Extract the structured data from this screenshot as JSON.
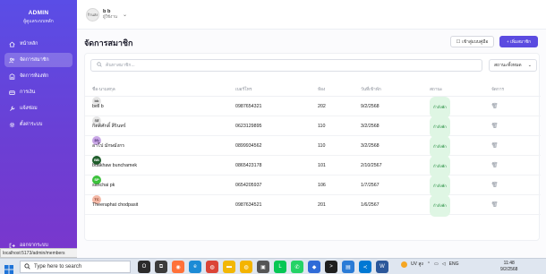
{
  "sidebar": {
    "title": "ADMIN",
    "subtitle": "ผู้ดูแลระบบหลัก",
    "items": [
      {
        "label": "หน้าหลัก",
        "icon": "home-icon",
        "active": false
      },
      {
        "label": "จัดการสมาชิก",
        "icon": "users-icon",
        "active": true
      },
      {
        "label": "จัดการห้องพัก",
        "icon": "room-icon",
        "active": false
      },
      {
        "label": "การเงิน",
        "icon": "wallet-icon",
        "active": false
      },
      {
        "label": "แจ้งซ่อม",
        "icon": "wrench-icon",
        "active": false
      },
      {
        "label": "ตั้งค่าระบบ",
        "icon": "gear-icon",
        "active": false
      }
    ],
    "logout": "ออกจากระบบ"
  },
  "status_url": "localhost:5173/admin/members",
  "header": {
    "user_avatar_text": "ร้านส่ง",
    "user_name": "b b",
    "user_role": "ผู้ใช้งาน"
  },
  "page": {
    "title": "จัดการสมาชิก",
    "manual_button": "เข้าสู่แบบคู่มือ",
    "add_button": "+ เพิ่มสมาชิก",
    "search_placeholder": "ค้นหาสมาชิก...",
    "filter_value": "สถานะทั้งหมด"
  },
  "table": {
    "headers": [
      "ชื่อ-นามสกุล",
      "เบอร์โทร",
      "ห้อง",
      "วันที่เข้าพัก",
      "สถานะ",
      "จัดการ"
    ],
    "rows": [
      {
        "initials": "bb",
        "avatar_color": "#e6e6e6",
        "avatar_text_color": "#444",
        "name": "bell b",
        "phone": "0987654321",
        "room": "202",
        "date": "9/2/2568",
        "status": "กำลังพัก"
      },
      {
        "initials": "กส",
        "avatar_color": "#e6e6e6",
        "avatar_text_color": "#444",
        "name": "กิตติศักดิ์ สีรินทร์",
        "phone": "0623129895",
        "room": "110",
        "date": "3/2/2568",
        "status": "กำลังพัก"
      },
      {
        "initials": "อน",
        "avatar_color": "#c9a7e6",
        "avatar_text_color": "#4a2a73",
        "name": "อาโป มักษมังกร",
        "phone": "0899934562",
        "room": "110",
        "date": "3/2/2568",
        "status": "กำลังพัก"
      },
      {
        "initials": "BB",
        "avatar_color": "#1f5d2b",
        "avatar_text_color": "#ffffff",
        "name": "buakhaw bunchamek",
        "phone": "0865423178",
        "room": "101",
        "date": "2/10/2567",
        "status": "กำลังพัก"
      },
      {
        "initials": "SP",
        "avatar_color": "#3cc23c",
        "avatar_text_color": "#ffffff",
        "name": "sanchai pk",
        "phone": "0654205937",
        "room": "106",
        "date": "1/7/2567",
        "status": "กำลังพัก"
      },
      {
        "initials": "TC",
        "avatar_color": "#f4b9a7",
        "avatar_text_color": "#7a2d14",
        "name": "Theeraphat chodpasit",
        "phone": "0987634521",
        "room": "201",
        "date": "1/6/2567",
        "status": "กำลังพัก"
      }
    ]
  },
  "taskbar": {
    "search_placeholder": "Type here to search",
    "weather": "UV สูง",
    "language": "ENG",
    "time": "11:48",
    "date": "9/2/2568",
    "apps": [
      {
        "icon": "cortana-icon",
        "color": "#2b2b2b",
        "glyph": "O"
      },
      {
        "icon": "task-view-icon",
        "color": "#3b3b3b",
        "glyph": "⧉"
      },
      {
        "icon": "firefox-icon",
        "color": "#ff7139",
        "glyph": "◉"
      },
      {
        "icon": "edge-icon",
        "color": "#1c8bd6",
        "glyph": "e"
      },
      {
        "icon": "chrome-icon",
        "color": "#db4437",
        "glyph": "◍"
      },
      {
        "icon": "file-explorer-icon",
        "color": "#f2b705",
        "glyph": "▬"
      },
      {
        "icon": "chrome-alt-icon",
        "color": "#f4b400",
        "glyph": "◍"
      },
      {
        "icon": "camera-icon",
        "color": "#555555",
        "glyph": "▣"
      },
      {
        "icon": "line-icon",
        "color": "#06c755",
        "glyph": "L"
      },
      {
        "icon": "whatsapp-icon",
        "color": "#25d366",
        "glyph": "✆"
      },
      {
        "icon": "app-blue-icon",
        "color": "#2f6bd8",
        "glyph": "◆"
      },
      {
        "icon": "terminal-icon",
        "color": "#1e1e1e",
        "glyph": ">"
      },
      {
        "icon": "image-icon",
        "color": "#2a7bd6",
        "glyph": "▤"
      },
      {
        "icon": "vscode-icon",
        "color": "#0078d4",
        "glyph": "≺"
      },
      {
        "icon": "word-icon",
        "color": "#2b579a",
        "glyph": "W"
      }
    ]
  },
  "colors": {
    "accent": "#5b4be0",
    "status_bg": "#dff6e4",
    "status_text": "#1f8a3b"
  }
}
